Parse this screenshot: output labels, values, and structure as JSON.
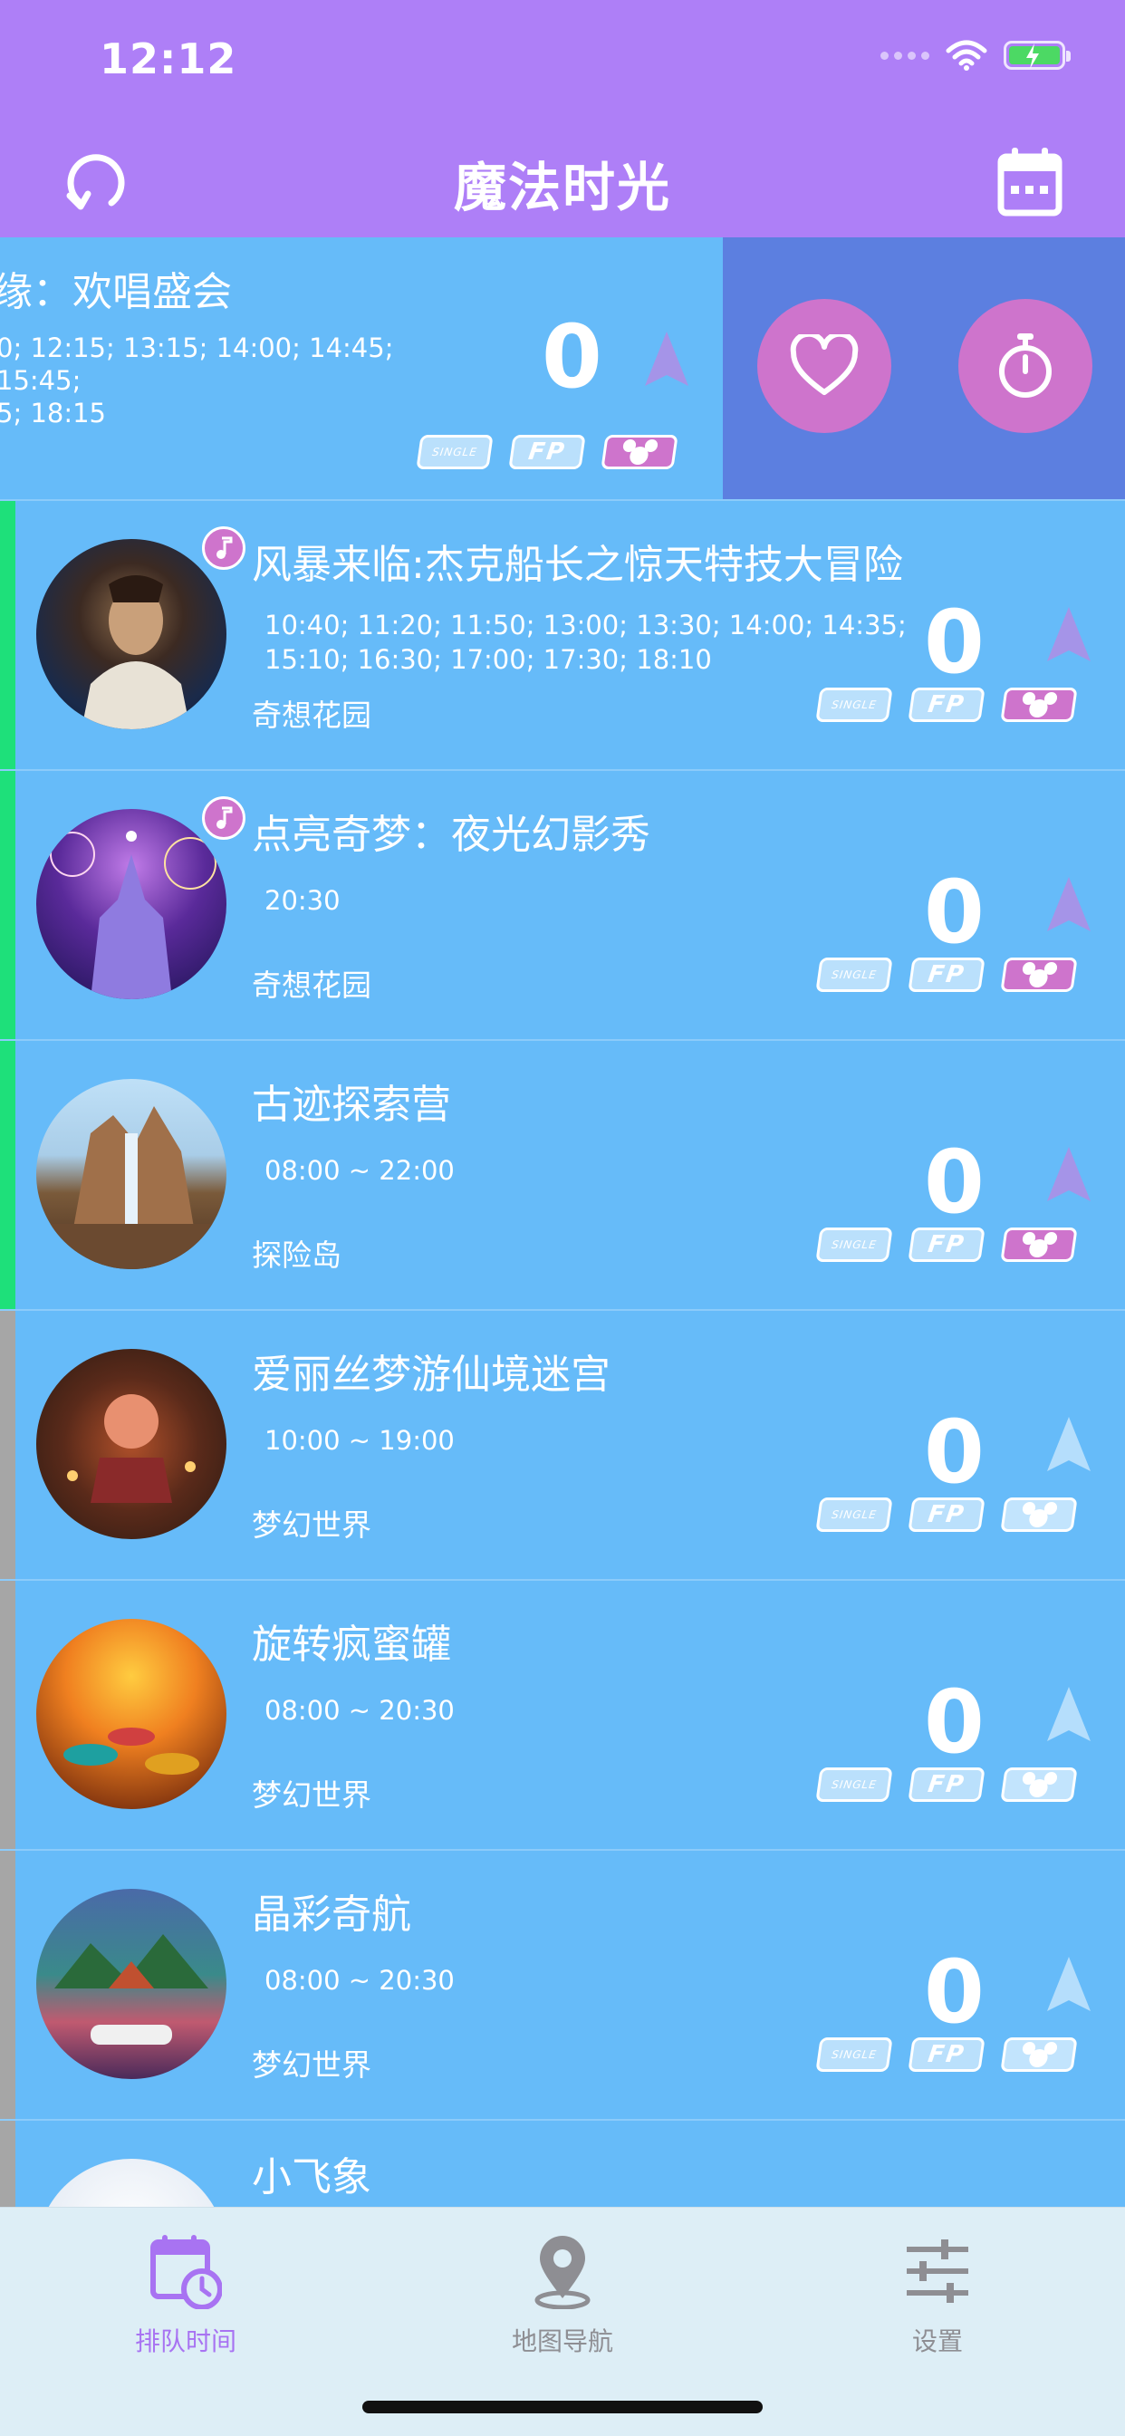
{
  "status_bar": {
    "time": "12:12"
  },
  "nav": {
    "title": "魔法时光",
    "left_icon": "refresh-icon",
    "right_icon": "calendar-icon"
  },
  "swiped_row": {
    "title": "缘：欢唱盛会",
    "times": "0; 12:15; 13:15; 14:00; 14:45; 15:45;\n5; 18:15",
    "wait": "0",
    "tags": [
      "SINGLE",
      "FP",
      "mickey"
    ],
    "actions": [
      "heart-icon",
      "stopwatch-icon"
    ]
  },
  "rows": [
    {
      "title": "风暴来临:杰克船长之惊天特技大冒险",
      "times": "10:40; 11:20; 11:50; 13:00; 13:30; 14:00; 14:35; 15:10; 16:30; 17:00; 17:30; 18:10",
      "area": "奇想花园",
      "wait": "0",
      "music": true,
      "status_color": "#1EE07A",
      "mickey_on": true
    },
    {
      "title": "点亮奇梦：夜光幻影秀",
      "times": "20:30",
      "area": "奇想花园",
      "wait": "0",
      "music": true,
      "status_color": "#1EE07A",
      "mickey_on": true
    },
    {
      "title": "古迹探索营",
      "times": "08:00 ~ 22:00",
      "area": "探险岛",
      "wait": "0",
      "music": false,
      "status_color": "#1EE07A",
      "mickey_on": true
    },
    {
      "title": "爱丽丝梦游仙境迷宫",
      "times": "10:00 ~ 19:00",
      "area": "梦幻世界",
      "wait": "0",
      "music": false,
      "status_color": "#A6A6A6",
      "mickey_on": false
    },
    {
      "title": "旋转疯蜜罐",
      "times": "08:00 ~ 20:30",
      "area": "梦幻世界",
      "wait": "0",
      "music": false,
      "status_color": "#A6A6A6",
      "mickey_on": false
    },
    {
      "title": "晶彩奇航",
      "times": "08:00 ~ 20:30",
      "area": "梦幻世界",
      "wait": "0",
      "music": false,
      "status_color": "#A6A6A6",
      "mickey_on": false
    },
    {
      "title": "小飞象",
      "times": "",
      "area": "",
      "wait": "",
      "music": false,
      "status_color": "#A6A6A6",
      "mickey_on": false
    }
  ],
  "tag_labels": {
    "single": "SINGLE",
    "fp": "FP"
  },
  "tabbar": {
    "tabs": [
      {
        "label": "排队时间",
        "icon": "calendar-clock-icon",
        "active": true
      },
      {
        "label": "地图导航",
        "icon": "map-pin-icon",
        "active": false
      },
      {
        "label": "设置",
        "icon": "sliders-icon",
        "active": false
      }
    ],
    "active_color": "#A873F2",
    "inactive_color": "#8E8E93"
  },
  "colors": {
    "header": "#AE7FF7",
    "list_bg": "#66BBF9",
    "action_bg": "#5C7FE0",
    "accent_pink": "#CE74CC"
  }
}
